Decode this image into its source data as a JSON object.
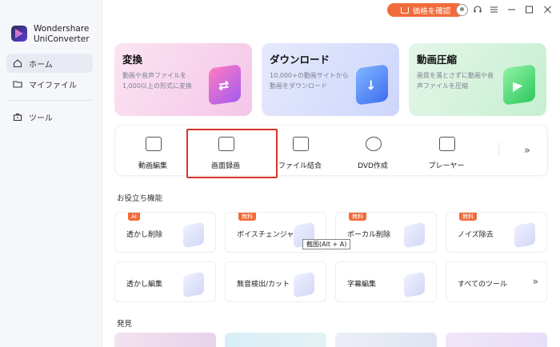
{
  "app": {
    "name": "Wondershare\nUniConverter",
    "name_line1": "Wondershare",
    "name_line2": "UniConverter"
  },
  "titlebar": {
    "price_label": "価格を確認",
    "accent": "#f26b3a"
  },
  "sidebar": {
    "items": [
      {
        "label": "ホーム",
        "icon": "home-icon",
        "active": true
      },
      {
        "label": "マイファイル",
        "icon": "folder-icon",
        "active": false
      }
    ],
    "tool_item": {
      "label": "ツール",
      "icon": "toolbox-icon"
    }
  },
  "features": [
    {
      "title": "変換",
      "desc": "動画や音声ファイルを1,000以上の形式に変換",
      "color": "#f4c6e8"
    },
    {
      "title": "ダウンロード",
      "desc": "10,000+の動画サイトから動画をダウンロード",
      "color": "#cdd6fb"
    },
    {
      "title": "動画圧縮",
      "desc": "画質を落とさずに動画や音声ファイルを圧縮",
      "color": "#c6efd0"
    }
  ],
  "tools": [
    {
      "label": "動画編集",
      "icon": "video-edit-icon"
    },
    {
      "label": "画面録画",
      "icon": "screen-record-icon"
    },
    {
      "label": "ファイル結合",
      "icon": "merge-icon"
    },
    {
      "label": "DVD作成",
      "icon": "dvd-icon"
    },
    {
      "label": "プレーヤー",
      "icon": "player-icon"
    }
  ],
  "sections": {
    "useful": "お役立ち機能",
    "discover": "発見"
  },
  "useful_cards": [
    {
      "label": "透かし削除",
      "badge": "AI"
    },
    {
      "label": "ボイスチェンジャー",
      "badge": "無料"
    },
    {
      "label": "ボーカル削除",
      "badge": "無料"
    },
    {
      "label": "ノイズ除去",
      "badge": "無料"
    },
    {
      "label": "透かし編集",
      "badge": ""
    },
    {
      "label": "無音検出/カット",
      "badge": ""
    },
    {
      "label": "字幕編集",
      "badge": ""
    },
    {
      "label": "すべてのツール",
      "badge": ""
    }
  ],
  "tooltip": "截图(Alt + A)"
}
